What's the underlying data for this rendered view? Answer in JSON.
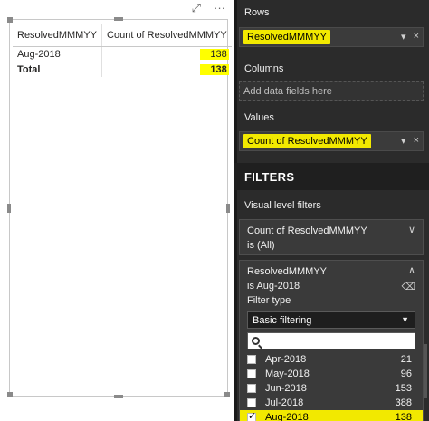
{
  "visual": {
    "icons": [
      "focus-mode-icon",
      "more-options-icon"
    ],
    "focus_glyph": "⤢",
    "more_glyph": "···",
    "headers": [
      "ResolvedMMMYY",
      "Count of ResolvedMMMYY"
    ],
    "rows": [
      {
        "label": "Aug-2018",
        "value": "138"
      }
    ],
    "total": {
      "label": "Total",
      "value": "138"
    },
    "highlight_color": "#ffff00"
  },
  "fields": {
    "rows_label": "Rows",
    "rows_field": "ResolvedMMMYY",
    "columns_label": "Columns",
    "columns_placeholder": "Add data fields here",
    "values_label": "Values",
    "values_field": "Count of ResolvedMMMYY",
    "remove_glyph": "×",
    "dropdown_glyph": "▾"
  },
  "filters": {
    "title": "FILTERS",
    "visual_level": "Visual level filters",
    "count_filter": {
      "field": "Count of ResolvedMMMYY",
      "state": "is (All)",
      "chevron": "∨"
    },
    "resolved_filter": {
      "field": "ResolvedMMMYY",
      "state": "is Aug-2018",
      "chevron": "∧",
      "eraser": "⌫",
      "filter_type_label": "Filter type",
      "filter_type_value": "Basic filtering",
      "caret": "▼",
      "items": [
        {
          "label": "Apr-2018",
          "count": "21",
          "checked": false
        },
        {
          "label": "May-2018",
          "count": "96",
          "checked": false
        },
        {
          "label": "Jun-2018",
          "count": "153",
          "checked": false
        },
        {
          "label": "Jul-2018",
          "count": "388",
          "checked": false
        },
        {
          "label": "Aug-2018",
          "count": "138",
          "checked": true
        }
      ]
    }
  },
  "colors": {
    "panel_bg": "#2b2b2b",
    "highlight": "#f2e900"
  }
}
